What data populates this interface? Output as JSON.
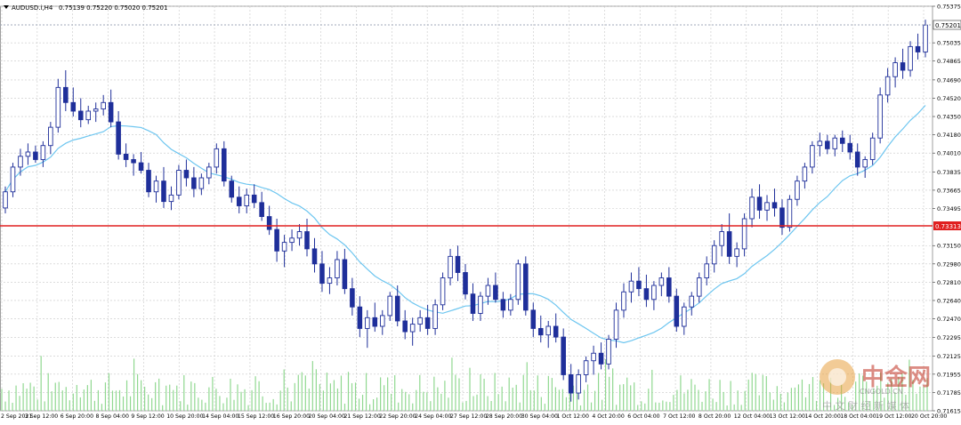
{
  "header": {
    "symbol_text": "AUDUSD.i,H4",
    "ohlc_text": "0.75139 0.75220 0.75020 0.75201"
  },
  "price_axis": {
    "labels": [
      "0.75375",
      "0.75035",
      "0.74865",
      "0.74690",
      "0.74520",
      "0.74350",
      "0.74180",
      "0.74010",
      "0.73835",
      "0.73665",
      "0.73495",
      "0.73150",
      "0.72980",
      "0.72810",
      "0.72640",
      "0.72470",
      "0.72295",
      "0.72125",
      "0.71955",
      "0.71785",
      "0.71615"
    ]
  },
  "time_axis": {
    "labels": [
      "2 Sep 2021",
      "3 Sep 12:00",
      "6 Sep 20:00",
      "8 Sep 04:00",
      "9 Sep 12:00",
      "10 Sep 20:00",
      "14 Sep 04:00",
      "15 Sep 12:00",
      "16 Sep 20:00",
      "20 Sep 04:00",
      "21 Sep 12:00",
      "22 Sep 20:00",
      "24 Sep 04:00",
      "27 Sep 12:00",
      "28 Sep 20:00",
      "30 Sep 04:00",
      "1 Oct 12:00",
      "4 Oct 20:00",
      "6 Oct 04:00",
      "7 Oct 12:00",
      "8 Oct 20:00",
      "12 Oct 04:00",
      "13 Oct 12:00",
      "14 Oct 20:00",
      "18 Oct 04:00",
      "19 Oct 12:00",
      "20 Oct 20:00"
    ]
  },
  "current_price_tag": "0.75201",
  "level_tag": "0.73313",
  "watermark": {
    "title": "中金网",
    "subtitle": "CNGOLD.CN",
    "tagline": "中 文 财 经 新 媒 体"
  },
  "colors": {
    "grid": "#c8c8c8",
    "bull_candle": "#1f2f9a",
    "bear_candle": "#1f2f9a",
    "ma_line": "#6ec6f0",
    "level_line": "#e02020",
    "volume": "#90d890",
    "current_line": "#a0a8b8"
  },
  "chart_data": {
    "type": "candlestick",
    "symbol": "AUDUSD.i",
    "timeframe": "H4",
    "ylim": [
      0.71615,
      0.75375
    ],
    "horizontal_level": 0.73313,
    "last_price": 0.75201,
    "ohlc": [
      [
        0.735,
        0.737,
        0.7345,
        0.7365
      ],
      [
        0.7365,
        0.7392,
        0.736,
        0.7388
      ],
      [
        0.7388,
        0.7405,
        0.738,
        0.7398
      ],
      [
        0.7398,
        0.741,
        0.739,
        0.7402
      ],
      [
        0.7402,
        0.7408,
        0.7392,
        0.7395
      ],
      [
        0.7395,
        0.7412,
        0.7388,
        0.7408
      ],
      [
        0.7408,
        0.743,
        0.74,
        0.7425
      ],
      [
        0.7425,
        0.747,
        0.742,
        0.7462
      ],
      [
        0.7462,
        0.7478,
        0.744,
        0.7448
      ],
      [
        0.7448,
        0.7462,
        0.7435,
        0.744
      ],
      [
        0.744,
        0.7452,
        0.7425,
        0.7432
      ],
      [
        0.7432,
        0.7445,
        0.7428,
        0.744
      ],
      [
        0.744,
        0.7448,
        0.743,
        0.7442
      ],
      [
        0.7442,
        0.7455,
        0.7436,
        0.7448
      ],
      [
        0.7448,
        0.746,
        0.7425,
        0.743
      ],
      [
        0.743,
        0.744,
        0.7395,
        0.74
      ],
      [
        0.74,
        0.741,
        0.7388,
        0.7395
      ],
      [
        0.7395,
        0.74,
        0.738,
        0.7392
      ],
      [
        0.7392,
        0.7402,
        0.7382,
        0.7385
      ],
      [
        0.7385,
        0.7392,
        0.736,
        0.7365
      ],
      [
        0.7365,
        0.738,
        0.7355,
        0.7375
      ],
      [
        0.7375,
        0.7388,
        0.735,
        0.7356
      ],
      [
        0.7356,
        0.737,
        0.7348,
        0.7362
      ],
      [
        0.7362,
        0.739,
        0.7358,
        0.7385
      ],
      [
        0.7385,
        0.7395,
        0.737,
        0.7378
      ],
      [
        0.7378,
        0.7388,
        0.736,
        0.7368
      ],
      [
        0.7368,
        0.7382,
        0.7362,
        0.7378
      ],
      [
        0.7378,
        0.7392,
        0.7372,
        0.7388
      ],
      [
        0.7388,
        0.741,
        0.7382,
        0.7405
      ],
      [
        0.7405,
        0.7412,
        0.737,
        0.7375
      ],
      [
        0.7375,
        0.738,
        0.7355,
        0.736
      ],
      [
        0.736,
        0.737,
        0.7345,
        0.7352
      ],
      [
        0.7352,
        0.7368,
        0.7345,
        0.7362
      ],
      [
        0.7362,
        0.7372,
        0.735,
        0.7355
      ],
      [
        0.7355,
        0.7365,
        0.7338,
        0.7342
      ],
      [
        0.7342,
        0.7352,
        0.7325,
        0.733
      ],
      [
        0.733,
        0.734,
        0.73,
        0.731
      ],
      [
        0.731,
        0.7325,
        0.7295,
        0.7318
      ],
      [
        0.7318,
        0.733,
        0.731,
        0.7322
      ],
      [
        0.7322,
        0.7335,
        0.7315,
        0.7328
      ],
      [
        0.7328,
        0.734,
        0.7305,
        0.7312
      ],
      [
        0.7312,
        0.7322,
        0.729,
        0.7298
      ],
      [
        0.7298,
        0.731,
        0.7272,
        0.728
      ],
      [
        0.728,
        0.7295,
        0.727,
        0.7285
      ],
      [
        0.7285,
        0.731,
        0.7278,
        0.7302
      ],
      [
        0.7302,
        0.7312,
        0.727,
        0.7275
      ],
      [
        0.7275,
        0.7285,
        0.725,
        0.7258
      ],
      [
        0.7258,
        0.7268,
        0.723,
        0.7238
      ],
      [
        0.7238,
        0.7255,
        0.722,
        0.7248
      ],
      [
        0.7248,
        0.7262,
        0.7235,
        0.724
      ],
      [
        0.724,
        0.7255,
        0.7232,
        0.725
      ],
      [
        0.725,
        0.7272,
        0.7245,
        0.7268
      ],
      [
        0.7268,
        0.7278,
        0.724,
        0.7245
      ],
      [
        0.7245,
        0.7255,
        0.7228,
        0.7235
      ],
      [
        0.7235,
        0.7248,
        0.7222,
        0.7242
      ],
      [
        0.7242,
        0.7255,
        0.7235,
        0.7248
      ],
      [
        0.7248,
        0.726,
        0.7232,
        0.7238
      ],
      [
        0.7238,
        0.7265,
        0.7232,
        0.726
      ],
      [
        0.726,
        0.729,
        0.7255,
        0.7285
      ],
      [
        0.7285,
        0.7312,
        0.7278,
        0.7305
      ],
      [
        0.7305,
        0.7315,
        0.7282,
        0.729
      ],
      [
        0.729,
        0.7298,
        0.7265,
        0.727
      ],
      [
        0.727,
        0.728,
        0.7245,
        0.7252
      ],
      [
        0.7252,
        0.7272,
        0.7245,
        0.7268
      ],
      [
        0.7268,
        0.7285,
        0.726,
        0.7278
      ],
      [
        0.7278,
        0.729,
        0.7262,
        0.7265
      ],
      [
        0.7265,
        0.7272,
        0.7248,
        0.7255
      ],
      [
        0.7255,
        0.727,
        0.725,
        0.7265
      ],
      [
        0.7265,
        0.7302,
        0.726,
        0.7298
      ],
      [
        0.7298,
        0.7305,
        0.725,
        0.7255
      ],
      [
        0.7255,
        0.7262,
        0.723,
        0.7238
      ],
      [
        0.7238,
        0.725,
        0.7225,
        0.7232
      ],
      [
        0.7232,
        0.7245,
        0.722,
        0.724
      ],
      [
        0.724,
        0.7252,
        0.7225,
        0.723
      ],
      [
        0.723,
        0.7238,
        0.719,
        0.7195
      ],
      [
        0.7195,
        0.7205,
        0.717,
        0.7178
      ],
      [
        0.7178,
        0.72,
        0.7172,
        0.7195
      ],
      [
        0.7195,
        0.7212,
        0.7188,
        0.7208
      ],
      [
        0.7208,
        0.7222,
        0.7195,
        0.7215
      ],
      [
        0.7215,
        0.7225,
        0.72,
        0.7205
      ],
      [
        0.7205,
        0.7232,
        0.72,
        0.7228
      ],
      [
        0.7228,
        0.7262,
        0.722,
        0.7255
      ],
      [
        0.7255,
        0.728,
        0.7248,
        0.7272
      ],
      [
        0.7272,
        0.729,
        0.7262,
        0.7282
      ],
      [
        0.7282,
        0.7295,
        0.7268,
        0.7275
      ],
      [
        0.7275,
        0.7288,
        0.7258,
        0.7265
      ],
      [
        0.7265,
        0.7282,
        0.7255,
        0.7278
      ],
      [
        0.7278,
        0.729,
        0.7268,
        0.7285
      ],
      [
        0.7285,
        0.7295,
        0.7262,
        0.7268
      ],
      [
        0.7268,
        0.7275,
        0.7235,
        0.724
      ],
      [
        0.724,
        0.7262,
        0.7232,
        0.7258
      ],
      [
        0.7258,
        0.7272,
        0.725,
        0.7268
      ],
      [
        0.7268,
        0.729,
        0.7262,
        0.7285
      ],
      [
        0.7285,
        0.7305,
        0.7278,
        0.7298
      ],
      [
        0.7298,
        0.732,
        0.729,
        0.7315
      ],
      [
        0.7315,
        0.7335,
        0.7305,
        0.7328
      ],
      [
        0.7328,
        0.7345,
        0.7298,
        0.7305
      ],
      [
        0.7305,
        0.7318,
        0.7295,
        0.7312
      ],
      [
        0.7312,
        0.7345,
        0.7305,
        0.734
      ],
      [
        0.734,
        0.7368,
        0.7332,
        0.736
      ],
      [
        0.736,
        0.7372,
        0.734,
        0.7348
      ],
      [
        0.7348,
        0.7362,
        0.7338,
        0.7355
      ],
      [
        0.7355,
        0.7368,
        0.7342,
        0.735
      ],
      [
        0.735,
        0.7358,
        0.7325,
        0.7332
      ],
      [
        0.7332,
        0.7362,
        0.7328,
        0.7358
      ],
      [
        0.7358,
        0.738,
        0.7352,
        0.7375
      ],
      [
        0.7375,
        0.7392,
        0.7368,
        0.7388
      ],
      [
        0.7388,
        0.7412,
        0.7382,
        0.7408
      ],
      [
        0.7408,
        0.742,
        0.7398,
        0.7412
      ],
      [
        0.7412,
        0.7418,
        0.74,
        0.7405
      ],
      [
        0.7405,
        0.7418,
        0.7398,
        0.7415
      ],
      [
        0.7415,
        0.7422,
        0.7402,
        0.741
      ],
      [
        0.741,
        0.7418,
        0.7395,
        0.7402
      ],
      [
        0.7402,
        0.741,
        0.738,
        0.7388
      ],
      [
        0.7388,
        0.7398,
        0.7378,
        0.7395
      ],
      [
        0.7395,
        0.742,
        0.739,
        0.7415
      ],
      [
        0.7415,
        0.7462,
        0.741,
        0.7455
      ],
      [
        0.7455,
        0.748,
        0.7448,
        0.7472
      ],
      [
        0.7472,
        0.749,
        0.7462,
        0.7485
      ],
      [
        0.7485,
        0.7498,
        0.747,
        0.7478
      ],
      [
        0.7478,
        0.7505,
        0.7472,
        0.75
      ],
      [
        0.75,
        0.7512,
        0.7488,
        0.7495
      ],
      [
        0.7495,
        0.7525,
        0.749,
        0.752
      ]
    ],
    "moving_average": "blue line trailing price, ending near 0.7455"
  }
}
